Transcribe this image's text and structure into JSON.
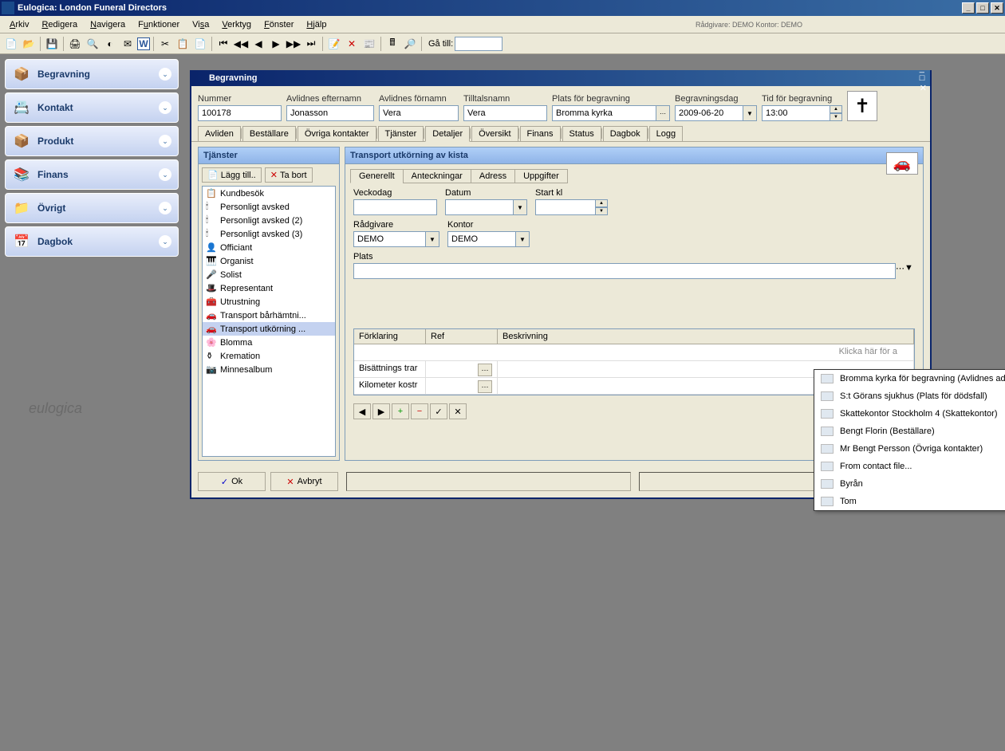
{
  "app": {
    "title": "Eulogica: London Funeral Directors",
    "status": "Rådgivare: DEMO   Kontor: DEMO"
  },
  "menu": [
    "Arkiv",
    "Redigera",
    "Navigera",
    "Funktioner",
    "Visa",
    "Verktyg",
    "Fönster",
    "Hjälp"
  ],
  "toolbar": {
    "goto_label": "Gå till:"
  },
  "sidebar": {
    "items": [
      {
        "label": "Begravning",
        "icon": "📦"
      },
      {
        "label": "Kontakt",
        "icon": "📇"
      },
      {
        "label": "Produkt",
        "icon": "📦"
      },
      {
        "label": "Finans",
        "icon": "📚"
      },
      {
        "label": "Övrigt",
        "icon": "📁"
      },
      {
        "label": "Dagbok",
        "icon": "📅"
      }
    ],
    "watermark": "eulogica"
  },
  "doc": {
    "title": "Begravning",
    "header": {
      "nummer": {
        "label": "Nummer",
        "value": "100178"
      },
      "efternamn": {
        "label": "Avlidnes efternamn",
        "value": "Jonasson"
      },
      "fornamn": {
        "label": "Avlidnes förnamn",
        "value": "Vera"
      },
      "tilltal": {
        "label": "Tilltalsnamn",
        "value": "Vera"
      },
      "plats": {
        "label": "Plats för begravning",
        "value": "Bromma kyrka"
      },
      "dag": {
        "label": "Begravningsdag",
        "value": "2009-06-20"
      },
      "tid": {
        "label": "Tid för begravning",
        "value": "13:00"
      }
    },
    "tabs": [
      "Avliden",
      "Beställare",
      "Övriga kontakter",
      "Tjänster",
      "Detaljer",
      "Översikt",
      "Finans",
      "Status",
      "Dagbok",
      "Logg"
    ],
    "active_tab": "Detaljer",
    "services": {
      "title": "Tjänster",
      "add": "Lägg till..",
      "remove": "Ta bort",
      "items": [
        {
          "icon": "📋",
          "label": "Kundbesök"
        },
        {
          "icon": "🕯",
          "label": "Personligt avsked"
        },
        {
          "icon": "🕯",
          "label": "Personligt avsked (2)"
        },
        {
          "icon": "🕯",
          "label": "Personligt avsked (3)"
        },
        {
          "icon": "👤",
          "label": "Officiant"
        },
        {
          "icon": "🎹",
          "label": "Organist"
        },
        {
          "icon": "🎤",
          "label": "Solist"
        },
        {
          "icon": "🎩",
          "label": "Representant"
        },
        {
          "icon": "🧰",
          "label": "Utrustning"
        },
        {
          "icon": "🚗",
          "label": "Transport bårhämtni..."
        },
        {
          "icon": "🚗",
          "label": "Transport utkörning ...",
          "selected": true
        },
        {
          "icon": "🌸",
          "label": "Blomma"
        },
        {
          "icon": "⚱",
          "label": "Kremation"
        },
        {
          "icon": "📷",
          "label": "Minnesalbum"
        }
      ]
    },
    "detail": {
      "title": "Transport utkörning av kista",
      "sub_tabs": [
        "Generellt",
        "Anteckningar",
        "Adress",
        "Uppgifter"
      ],
      "active_sub": "Generellt",
      "fields": {
        "veckodag": "Veckodag",
        "datum": "Datum",
        "start": "Start kl",
        "radgivare": {
          "label": "Rådgivare",
          "value": "DEMO"
        },
        "kontor": {
          "label": "Kontor",
          "value": "DEMO"
        },
        "plats": "Plats"
      },
      "dropdown": [
        "Bromma kyrka för begravning (Avlidnes adress)",
        "S:t Görans sjukhus (Plats för dödsfall)",
        "Skattekontor Stockholm 4 (Skattekontor)",
        "Bengt Florin (Beställare)",
        "Mr Bengt Persson (Övriga kontakter)",
        "From contact file...",
        "Byrån",
        "Tom"
      ],
      "grid": {
        "headers": [
          "Förklaring",
          "Ref",
          "Beskrivning"
        ],
        "placeholder": "Klicka här för a",
        "rows": [
          "Bisättnings trar",
          "Kilometer kostr"
        ]
      }
    },
    "footer": {
      "ok": "Ok",
      "cancel": "Avbryt"
    }
  }
}
